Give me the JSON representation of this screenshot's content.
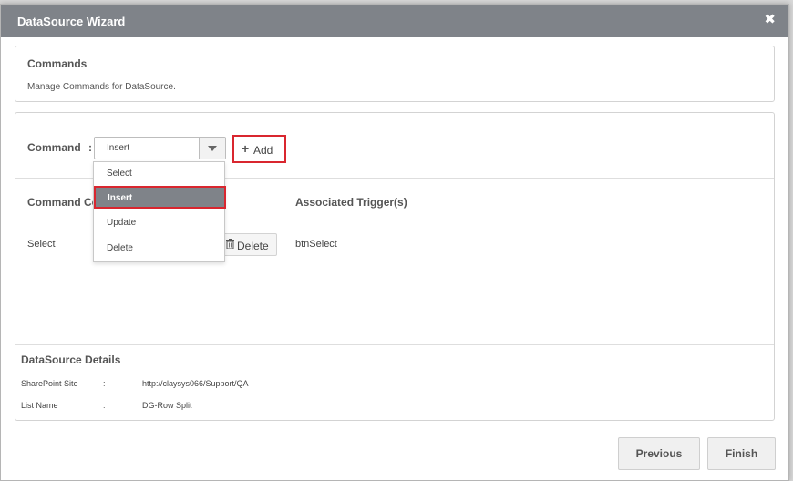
{
  "dialog": {
    "title": "DataSource Wizard",
    "close_icon": "close-icon"
  },
  "header": {
    "heading": "Commands",
    "subtitle": "Manage Commands for DataSource."
  },
  "command_picker": {
    "label": "Command",
    "colon": ":",
    "selected": "Insert",
    "add_label": "Add",
    "add_icon": "plus-icon"
  },
  "dropdown": {
    "options": [
      "Select",
      "Insert",
      "Update",
      "Delete"
    ],
    "highlighted": "Insert"
  },
  "table": {
    "col_command": "Command Co",
    "col_trigger": "Associated Trigger(s)",
    "rows": [
      {
        "command": "Select",
        "delete_label": "Delete",
        "trigger": "btnSelect"
      }
    ]
  },
  "details": {
    "heading": "DataSource Details",
    "rows": [
      {
        "key": "SharePoint Site",
        "sep": ":",
        "value": "http://claysys066/Support/QA"
      },
      {
        "key": "List Name",
        "sep": ":",
        "value": "DG-Row Split"
      }
    ]
  },
  "footer": {
    "previous_label": "Previous",
    "finish_label": "Finish"
  },
  "colors": {
    "titlebar": "#7f8389",
    "highlight_border": "#d9262f"
  }
}
